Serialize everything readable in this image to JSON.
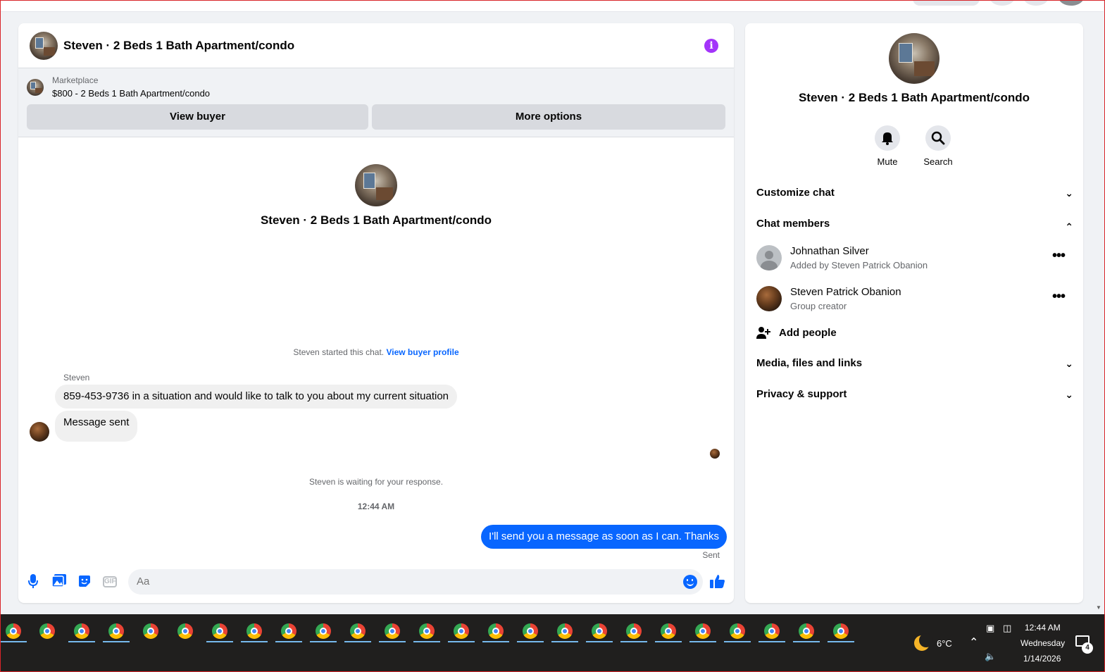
{
  "chat": {
    "header_title": "Steven · 2 Beds 1 Bath Apartment/condo",
    "marketplace_label": "Marketplace",
    "marketplace_item": "$800 - 2 Beds 1 Bath Apartment/condo",
    "view_buyer": "View buyer",
    "more_options": "More options",
    "conversation_title": "Steven · 2 Beds 1 Bath Apartment/condo",
    "started_text": "Steven started this chat.",
    "view_buyer_profile": "View buyer profile",
    "sender_name": "Steven",
    "messages_in": [
      "859-453-9736 in a situation and would like to talk to you about my current situation",
      "Message sent"
    ],
    "waiting_text": "Steven is waiting for your response.",
    "timestamp": "12:44 AM",
    "message_out": "I'll send you a message as soon as I can. Thanks",
    "sent_status": "Sent",
    "composer_placeholder": "Aa",
    "gif_label": "GIF"
  },
  "info": {
    "title": "Steven · 2 Beds 1 Bath Apartment/condo",
    "mute": "Mute",
    "search": "Search",
    "sections": {
      "customize": "Customize chat",
      "members": "Chat members",
      "media": "Media, files and links",
      "privacy": "Privacy & support"
    },
    "members": [
      {
        "name": "Johnathan Silver",
        "subtitle": "Added by Steven Patrick Obanion"
      },
      {
        "name": "Steven Patrick Obanion",
        "subtitle": "Group creator"
      }
    ],
    "add_people": "Add people"
  },
  "taskbar": {
    "temperature": "6°C",
    "time": "12:44 AM",
    "day": "Wednesday",
    "date": "1/14/2026",
    "notification_count": "4",
    "app_icons": [
      "chrome-icon"
    ]
  },
  "colors": {
    "accent": "#0866ff",
    "info_purple": "#a334fa",
    "taskbar": "#201f1e"
  }
}
